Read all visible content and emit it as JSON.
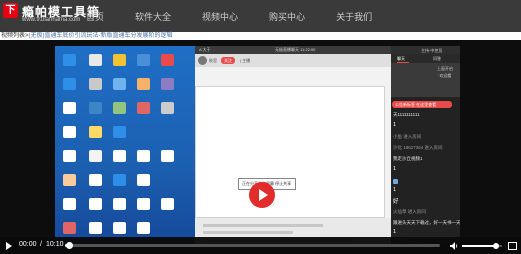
{
  "logo": {
    "mark": "下",
    "title": "瘾帕模工具箱",
    "subtitle": "www.91lianhama.com"
  },
  "nav": {
    "items": [
      "首页",
      "软件大全",
      "视频中心",
      "购买中心",
      "关于我们"
    ]
  },
  "breadcrumb": {
    "lead": "视频列表>",
    "text": "(无极)直通车底价引流玩法-新版直通车分发展阶的逻辑"
  },
  "screen": {
    "top_title": "无极直播聊天 11:22:00",
    "top_left": "A 大于",
    "user_name": "秋官",
    "tag": "关注",
    "tab_label": "| 主播",
    "dialog_text": "正在分享你的屏幕  停止共享"
  },
  "chat": {
    "header_name": "主持·中控员",
    "tabs": [
      "聊天",
      "问答"
    ],
    "gray_line1": "上面开启",
    "gray_line2": "· 欢迎看",
    "notice": "公告新标签 在这里查看",
    "messages": [
      "天1111111111",
      "1",
      "小鱼  进入房间",
      "沙化 18627364 进入房间",
      "我走沙丘视频1",
      "1",
      "1",
      "好",
      "火仙草  进入房间",
      "跟进头天天下载过，好一天书一天",
      "1",
      "小鸡  进入房间"
    ]
  },
  "controls": {
    "current_time": "00:00",
    "separator": "/",
    "duration": "10:10",
    "progress_fraction": 0.01,
    "volume_fraction": 0.85
  },
  "colors": {
    "accent": "#e22b2b",
    "nav_bg": "#3a3a3a",
    "desktop_bg": "#1f6fc6"
  },
  "icons": [
    "play-icon",
    "volume-icon",
    "fullscreen-icon",
    "desktop-app-icon"
  ]
}
